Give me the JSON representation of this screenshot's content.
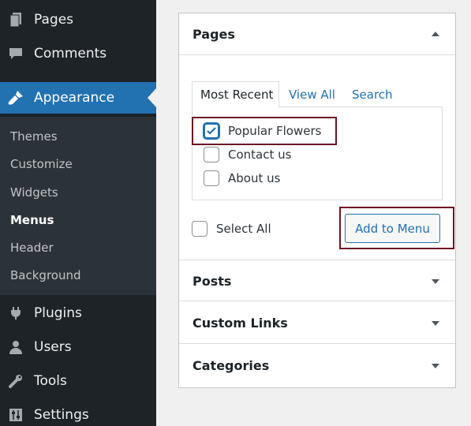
{
  "sidebar": {
    "top_items": [
      {
        "label": "Pages",
        "icon": "pages-icon"
      },
      {
        "label": "Comments",
        "icon": "comments-icon"
      },
      {
        "label": "Appearance",
        "icon": "appearance-icon"
      },
      {
        "label": "Plugins",
        "icon": "plugins-icon"
      },
      {
        "label": "Users",
        "icon": "users-icon"
      },
      {
        "label": "Tools",
        "icon": "tools-icon"
      },
      {
        "label": "Settings",
        "icon": "settings-icon"
      }
    ],
    "submenu": [
      "Themes",
      "Customize",
      "Widgets",
      "Menus",
      "Header",
      "Background"
    ],
    "current_submenu": "Menus",
    "active_color": "#2271b1"
  },
  "panel": {
    "pages": {
      "title": "Pages",
      "tabs": [
        "Most Recent",
        "View All",
        "Search"
      ],
      "items": [
        {
          "label": "Popular Flowers",
          "checked": true
        },
        {
          "label": "Contact us",
          "checked": false
        },
        {
          "label": "About us",
          "checked": false
        }
      ],
      "select_all": "Select All",
      "add_button": "Add to Menu"
    },
    "sections": [
      "Posts",
      "Custom Links",
      "Categories"
    ]
  }
}
